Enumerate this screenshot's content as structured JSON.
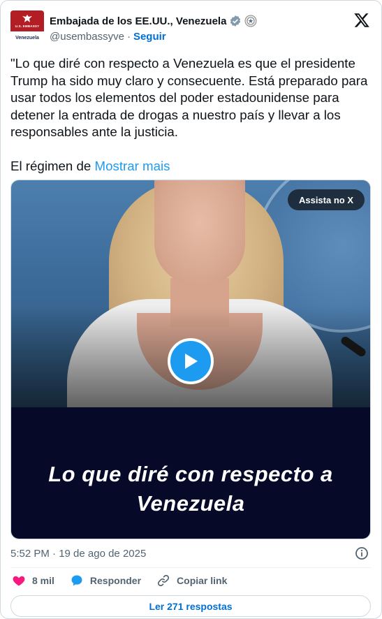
{
  "author": {
    "name": "Embajada de los EE.UU., Venezuela",
    "handle": "@usembassyve",
    "separator": "·",
    "follow_label": "Seguir",
    "avatar_embassy_text": "U.S. EMBASSY",
    "avatar_label": "Venezuela"
  },
  "tweet": {
    "text_paragraph_1": "\"Lo que diré con respecto a Venezuela es que el presidente Trump ha sido muy claro y consecuente. Está preparado para usar todos los elementos del poder estadounidense para detener la entrada de drogas a nuestro país y llevar a los responsables ante la justicia.",
    "text_paragraph_2": "El régimen de",
    "show_more_label": "Mostrar mais"
  },
  "media": {
    "watch_on_x_label": "Assista no X",
    "caption_line_1": "Lo que diré con respecto a",
    "caption_line_2": "Venezuela"
  },
  "meta": {
    "timestamp": "5:52 PM · 19 de ago de 2025"
  },
  "actions": {
    "likes_count": "8 mil",
    "reply_label": "Responder",
    "copy_link_label": "Copiar link"
  },
  "read_replies_label": "Ler 271 respostas",
  "colors": {
    "accent": "#1d9bf0",
    "link_blue": "#006fd6",
    "heart": "#f91880",
    "text_secondary": "#536471",
    "caption_bg": "#060a28"
  },
  "icons": {
    "verified": "verified-badge-icon",
    "gov_affiliation": "government-seal-icon",
    "logo": "x-logo-icon",
    "play": "play-icon",
    "info": "info-icon",
    "like": "heart-icon",
    "reply": "speech-bubble-icon",
    "copy_link": "link-icon"
  }
}
